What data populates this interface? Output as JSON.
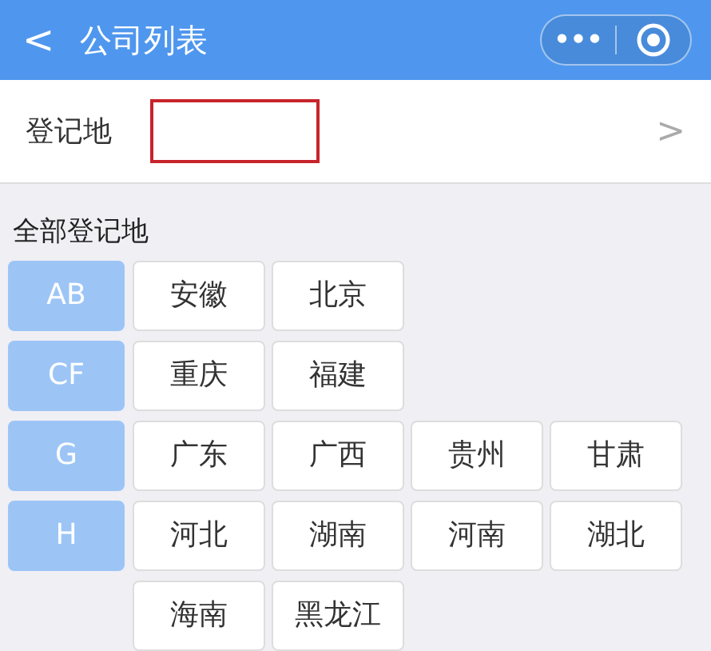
{
  "header": {
    "back": "<",
    "title": "公司列表",
    "menu": "•••"
  },
  "filter": {
    "label": "登记地",
    "chevron": ">"
  },
  "section_title": "全部登记地",
  "groups": [
    {
      "letter": "AB",
      "cities": [
        "安徽",
        "北京"
      ]
    },
    {
      "letter": "CF",
      "cities": [
        "重庆",
        "福建"
      ]
    },
    {
      "letter": "G",
      "cities": [
        "广东",
        "广西",
        "贵州",
        "甘肃"
      ]
    },
    {
      "letter": "H",
      "cities": [
        "河北",
        "湖南",
        "河南",
        "湖北",
        "海南",
        "黑龙江"
      ]
    }
  ]
}
